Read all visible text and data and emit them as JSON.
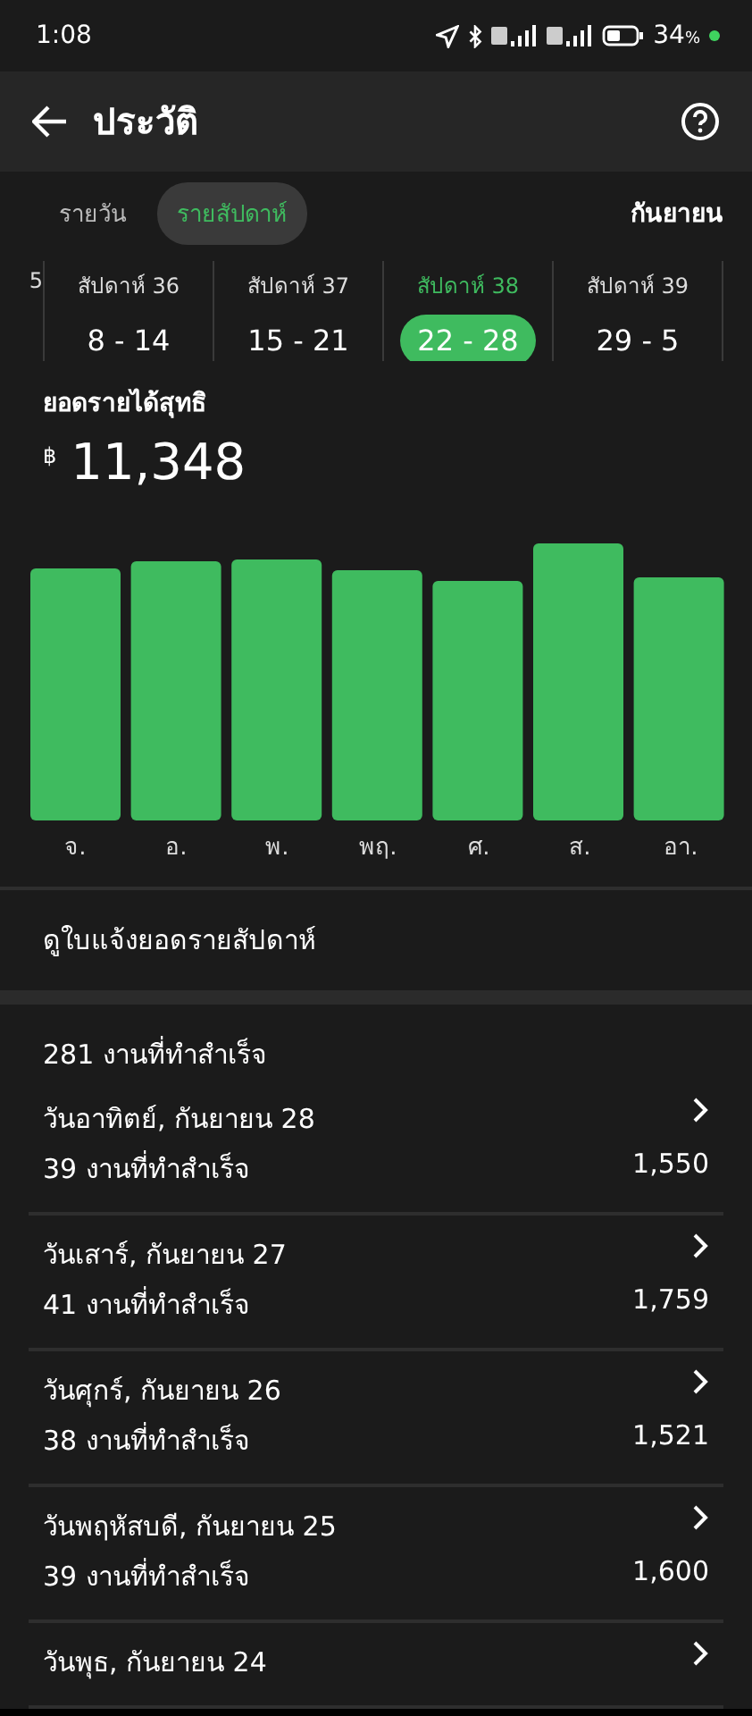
{
  "status_bar": {
    "time": "1:08",
    "battery": "34",
    "battery_unit": "%"
  },
  "header": {
    "title": "ประวัติ"
  },
  "period_tabs": [
    {
      "label": "รายวัน",
      "selected": false
    },
    {
      "label": "รายสัปดาห์",
      "selected": true
    }
  ],
  "month": "กันยายน",
  "weeks": [
    {
      "label": "5",
      "selected": false
    },
    {
      "label": "สัปดาห์ 36",
      "range": "8 - 14",
      "selected": false
    },
    {
      "label": "สัปดาห์ 37",
      "range": "15 - 21",
      "selected": false
    },
    {
      "label": "สัปดาห์ 38",
      "range": "22 - 28",
      "selected": true
    },
    {
      "label": "สัปดาห์ 39",
      "range": "29 - 5",
      "selected": false
    }
  ],
  "earnings": {
    "label": "ยอดรายได้สุทธิ",
    "currency": "฿",
    "amount": "11,348"
  },
  "chart": {
    "days": [
      "จ.",
      "อ.",
      "พ.",
      "พฤ.",
      "ศ.",
      "ส.",
      "อา."
    ]
  },
  "statement_link": "ดูใบแจ้งยอดรายสัปดาห์",
  "completed_header": "281 งานที่ทำสำเร็จ",
  "days": [
    {
      "date": "วันอาทิตย์, กันยายน 28",
      "jobs": "39 งานที่ทำสำเร็จ",
      "amount": "1,550"
    },
    {
      "date": "วันเสาร์, กันยายน 27",
      "jobs": "41 งานที่ทำสำเร็จ",
      "amount": "1,759"
    },
    {
      "date": "วันศุกร์, กันยายน 26",
      "jobs": "38 งานที่ทำสำเร็จ",
      "amount": "1,521"
    },
    {
      "date": "วันพฤหัสบดี, กันยายน 25",
      "jobs": "39 งานที่ทำสำเร็จ",
      "amount": "1,600"
    },
    {
      "date": "วันพุธ, กันยายน 24"
    }
  ]
}
